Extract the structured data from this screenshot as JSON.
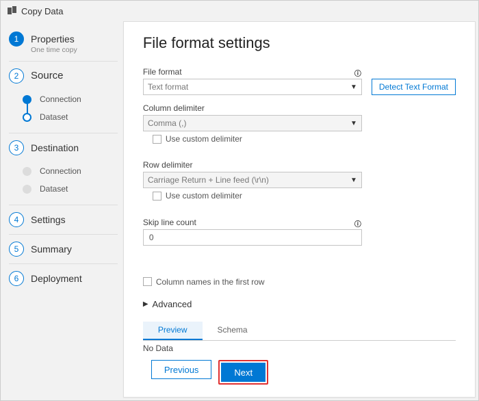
{
  "topbar": {
    "icon": "⯃⯃",
    "title": "Copy Data"
  },
  "sidebar": {
    "steps": [
      {
        "num": "1",
        "title": "Properties",
        "sub": "One time copy"
      },
      {
        "num": "2",
        "title": "Source"
      },
      {
        "num": "3",
        "title": "Destination"
      },
      {
        "num": "4",
        "title": "Settings"
      },
      {
        "num": "5",
        "title": "Summary"
      },
      {
        "num": "6",
        "title": "Deployment"
      }
    ],
    "source_substeps": {
      "connection": "Connection",
      "dataset": "Dataset"
    },
    "dest_substeps": {
      "connection": "Connection",
      "dataset": "Dataset"
    }
  },
  "main": {
    "heading": "File format settings",
    "file_format": {
      "label": "File format",
      "value": "Text format",
      "info": "ⓘ"
    },
    "detect_btn": "Detect Text Format",
    "col_delimiter": {
      "label": "Column delimiter",
      "value": "Comma (,)",
      "custom": "Use custom delimiter"
    },
    "row_delimiter": {
      "label": "Row delimiter",
      "value": "Carriage Return + Line feed (\\r\\n)",
      "custom": "Use custom delimiter"
    },
    "skip": {
      "label": "Skip line count",
      "value": "0",
      "info": "ⓘ"
    },
    "colnames_chk": "Column names in the first row",
    "advanced": "Advanced",
    "tabs": {
      "preview": "Preview",
      "schema": "Schema"
    },
    "nodata": "No Data",
    "footer": {
      "prev": "Previous",
      "next": "Next"
    }
  }
}
